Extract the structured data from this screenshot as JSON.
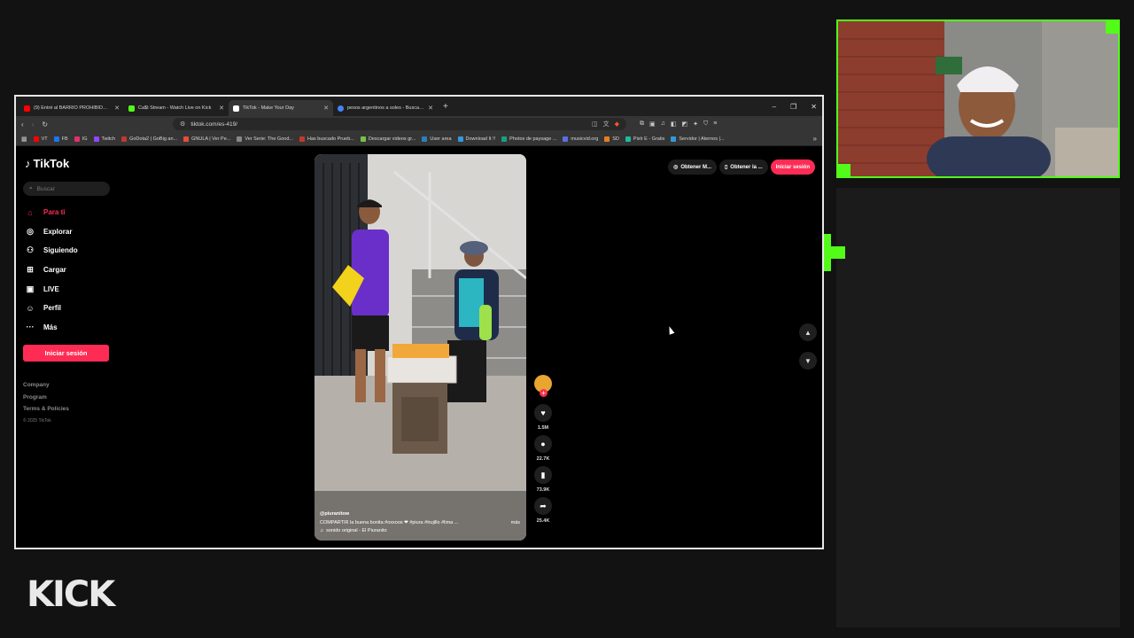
{
  "browser": {
    "tabs": [
      {
        "title": "(9) Entré al BARRIO PROHIBIDO de P",
        "color": "#ff0000",
        "active": false
      },
      {
        "title": "Ca$t Stream - Watch Live on Kick",
        "color": "#53fc18",
        "active": false
      },
      {
        "title": "TikTok - Make Your Day",
        "color": "#ffffff",
        "active": true
      },
      {
        "title": "pesos argentinos a soles - Buscar con",
        "color": "#4285f4",
        "active": false
      }
    ],
    "url": "tiktok.com/es-419/",
    "bookmarks": [
      {
        "label": "VT",
        "color": "#ff0000"
      },
      {
        "label": "FB",
        "color": "#1877f2"
      },
      {
        "label": "IG",
        "color": "#e1306c"
      },
      {
        "label": "Twitch",
        "color": "#9146ff"
      },
      {
        "label": "GoDota2 | GoBig an...",
        "color": "#c0392b"
      },
      {
        "label": "GNULA | Ver Pe...",
        "color": "#e74c3c"
      },
      {
        "label": "Ver Serie: The Good...",
        "color": "#888888"
      },
      {
        "label": "Has buscado Prueb...",
        "color": "#c0392b"
      },
      {
        "label": "Descargar videos gr...",
        "color": "#7ac143"
      },
      {
        "label": "User area",
        "color": "#2980b9"
      },
      {
        "label": "Download It !!",
        "color": "#3498db"
      },
      {
        "label": "Photos de paysage ...",
        "color": "#16a085"
      },
      {
        "label": "musicvid.org",
        "color": "#5b6ee1"
      },
      {
        "label": "SD",
        "color": "#e67e22"
      },
      {
        "label": "Pixlr E - Gratis",
        "color": "#1abc9c"
      },
      {
        "label": "Servidor | Aternos |...",
        "color": "#3498db"
      }
    ]
  },
  "tiktok": {
    "logo": "TikTok",
    "search_placeholder": "Buscar",
    "nav": [
      {
        "label": "Para ti",
        "icon": "home-icon",
        "active": true
      },
      {
        "label": "Explorar",
        "icon": "compass-icon",
        "active": false
      },
      {
        "label": "Siguiendo",
        "icon": "following-icon",
        "active": false
      },
      {
        "label": "Cargar",
        "icon": "upload-icon",
        "active": false
      },
      {
        "label": "LIVE",
        "icon": "live-icon",
        "active": false
      },
      {
        "label": "Perfil",
        "icon": "profile-icon",
        "active": false
      },
      {
        "label": "Más",
        "icon": "more-icon",
        "active": false
      }
    ],
    "login_button": "Iniciar sesión",
    "footer_links": [
      "Company",
      "Program",
      "Terms & Policies"
    ],
    "copyright": "© 2025 TikTok",
    "top_buttons": {
      "get_app": "Obtener M...",
      "get_pc": "Obtener la ...",
      "login": "Iniciar sesión"
    },
    "video": {
      "username": "@piuranitow",
      "description": "COMPARTIR la buena bonita #oxxoos ❤ #piura #trujillo #lima ...",
      "more": "más",
      "sound": "sonido original - El Piuranito"
    },
    "actions": {
      "likes": "1.5M",
      "comments": "22.7K",
      "saves": "73.9K",
      "shares": "25.4K"
    }
  },
  "stream": {
    "brand": "KICK",
    "accent": "#53fc18"
  }
}
